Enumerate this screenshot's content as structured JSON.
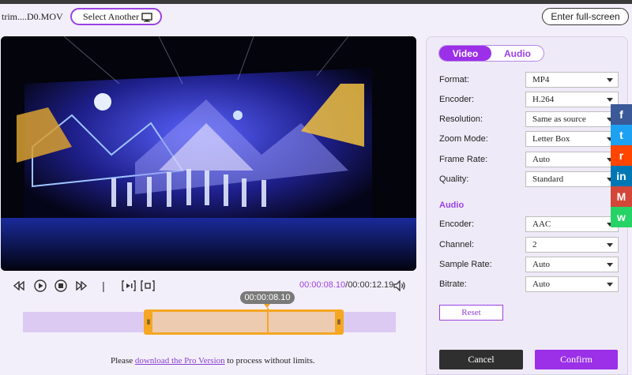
{
  "header": {
    "filename": "trim....D0.MOV",
    "select_another_label": "Select Another",
    "fullscreen_label": "Enter full-screen"
  },
  "player": {
    "current_time": "00:00:08.10",
    "separator": "/",
    "total_time": "00:00:12.19",
    "divider": "|",
    "icons": [
      "rewind-icon",
      "play-icon",
      "stop-icon",
      "forward-icon",
      "set-start-icon",
      "set-end-icon",
      "volume-icon"
    ]
  },
  "timeline": {
    "tooltip": "00:00:08.10",
    "selection_start_fraction": 0.325,
    "selection_end_fraction": 0.86,
    "playhead_fraction": 0.655
  },
  "footer_note": {
    "before": "Please ",
    "link": "download the Pro Version",
    "after": " to process without limits."
  },
  "settings": {
    "tabs": [
      {
        "label": "Video",
        "active": true
      },
      {
        "label": "Audio",
        "active": false
      }
    ],
    "video_rows": [
      {
        "label": "Format:",
        "value": "MP4"
      },
      {
        "label": "Encoder:",
        "value": "H.264"
      },
      {
        "label": "Resolution:",
        "value": "Same as source"
      },
      {
        "label": "Zoom Mode:",
        "value": "Letter Box"
      },
      {
        "label": "Frame Rate:",
        "value": "Auto"
      },
      {
        "label": "Quality:",
        "value": "Standard"
      }
    ],
    "audio_heading": "Audio",
    "audio_rows": [
      {
        "label": "Encoder:",
        "value": "AAC"
      },
      {
        "label": "Channel:",
        "value": "2"
      },
      {
        "label": "Sample Rate:",
        "value": "Auto"
      },
      {
        "label": "Bitrate:",
        "value": "Auto"
      }
    ],
    "reset_label": "Reset",
    "cancel_label": "Cancel",
    "confirm_label": "Confirm"
  },
  "share_bar": [
    {
      "name": "facebook-icon",
      "glyph": "f",
      "color": "#3b5998"
    },
    {
      "name": "twitter-icon",
      "glyph": "t",
      "color": "#1da1f2"
    },
    {
      "name": "reddit-icon",
      "glyph": "r",
      "color": "#ff4500"
    },
    {
      "name": "linkedin-icon",
      "glyph": "in",
      "color": "#0077b5"
    },
    {
      "name": "gmail-icon",
      "glyph": "M",
      "color": "#d44638"
    },
    {
      "name": "whatsapp-icon",
      "glyph": "w",
      "color": "#25d366"
    }
  ],
  "colors": {
    "accent": "#9b30e8",
    "trim_highlight": "#f5a623",
    "timeline_track": "#dccaf3"
  }
}
